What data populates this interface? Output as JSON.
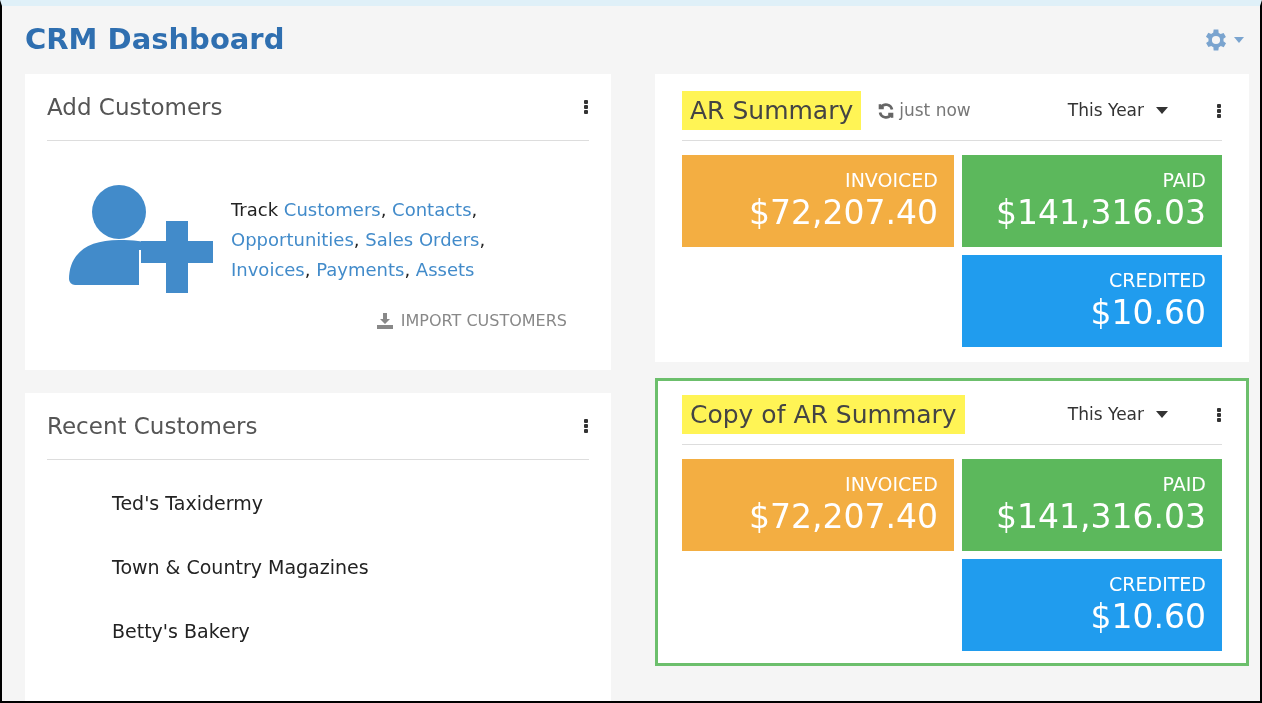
{
  "page_title": "CRM Dashboard",
  "add_customers": {
    "title": "Add Customers",
    "lead": "Track",
    "separator": ",",
    "links": [
      "Customers",
      "Contacts",
      "Opportunities",
      "Sales Orders",
      "Invoices",
      "Payments",
      "Assets"
    ],
    "import_label": "IMPORT CUSTOMERS"
  },
  "recent_customers": {
    "title": "Recent Customers",
    "items": [
      "Ted's Taxidermy",
      "Town & Country Magazines",
      "Betty's Bakery"
    ]
  },
  "widgets": [
    {
      "title": "AR Summary",
      "highlighted": true,
      "selected": false,
      "refreshed": "just now",
      "period": "This Year",
      "tiles": [
        {
          "label": "INVOICED",
          "value": "$72,207.40",
          "color": "#f3ae42"
        },
        {
          "label": "PAID",
          "value": "$141,316.03",
          "color": "#5cb85c"
        },
        {
          "label": "CREDITED",
          "value": "$10.60",
          "color": "#209cee"
        }
      ]
    },
    {
      "title": "Copy of AR Summary",
      "highlighted": true,
      "selected": true,
      "period": "This Year",
      "tiles": [
        {
          "label": "INVOICED",
          "value": "$72,207.40",
          "color": "#f3ae42"
        },
        {
          "label": "PAID",
          "value": "$141,316.03",
          "color": "#5cb85c"
        },
        {
          "label": "CREDITED",
          "value": "$10.60",
          "color": "#209cee"
        }
      ]
    }
  ]
}
